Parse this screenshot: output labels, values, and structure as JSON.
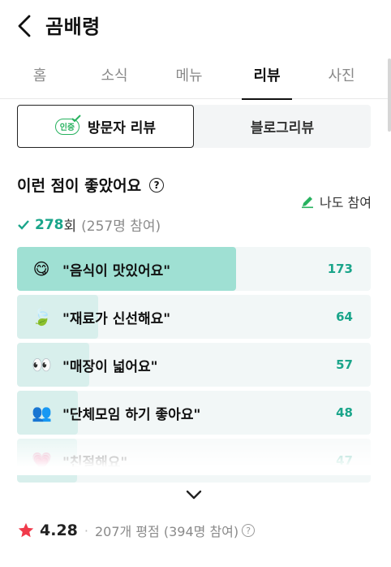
{
  "header": {
    "title": "곰배령"
  },
  "tabs": [
    {
      "label": "홈"
    },
    {
      "label": "소식"
    },
    {
      "label": "메뉴"
    },
    {
      "label": "리뷰",
      "active": true
    },
    {
      "label": "사진"
    }
  ],
  "review_toggle": {
    "visitor_label": "방문자 리뷰",
    "badge_text": "인증",
    "blog_label": "블로그리뷰"
  },
  "highlights": {
    "title": "이런 점이 좋았어요",
    "help_icon": "?",
    "me_too": "나도 참여",
    "count_prefix": "278",
    "count_unit": "회",
    "count_sub": "(257명 참여)",
    "items": [
      {
        "label": "\"음식이 맛있어요\"",
        "count": "173",
        "emoji": "😋",
        "fraction": 0.62
      },
      {
        "label": "\"재료가 신선해요\"",
        "count": "64",
        "emoji": "🍃",
        "fraction": 0.23
      },
      {
        "label": "\"매장이 넓어요\"",
        "count": "57",
        "emoji": "👀",
        "fraction": 0.205
      },
      {
        "label": "\"단체모임 하기 좋아요\"",
        "count": "48",
        "emoji": "👥",
        "fraction": 0.172
      },
      {
        "label": "\"친절해요\"",
        "count": "47",
        "emoji": "💗",
        "fraction": 0.17
      }
    ]
  },
  "rating": {
    "score": "4.28",
    "reviews": "207개 평점 (394명 참여)"
  },
  "colors": {
    "accent": "#1aa58a",
    "green": "#27b25f",
    "star": "#f03a4b"
  }
}
